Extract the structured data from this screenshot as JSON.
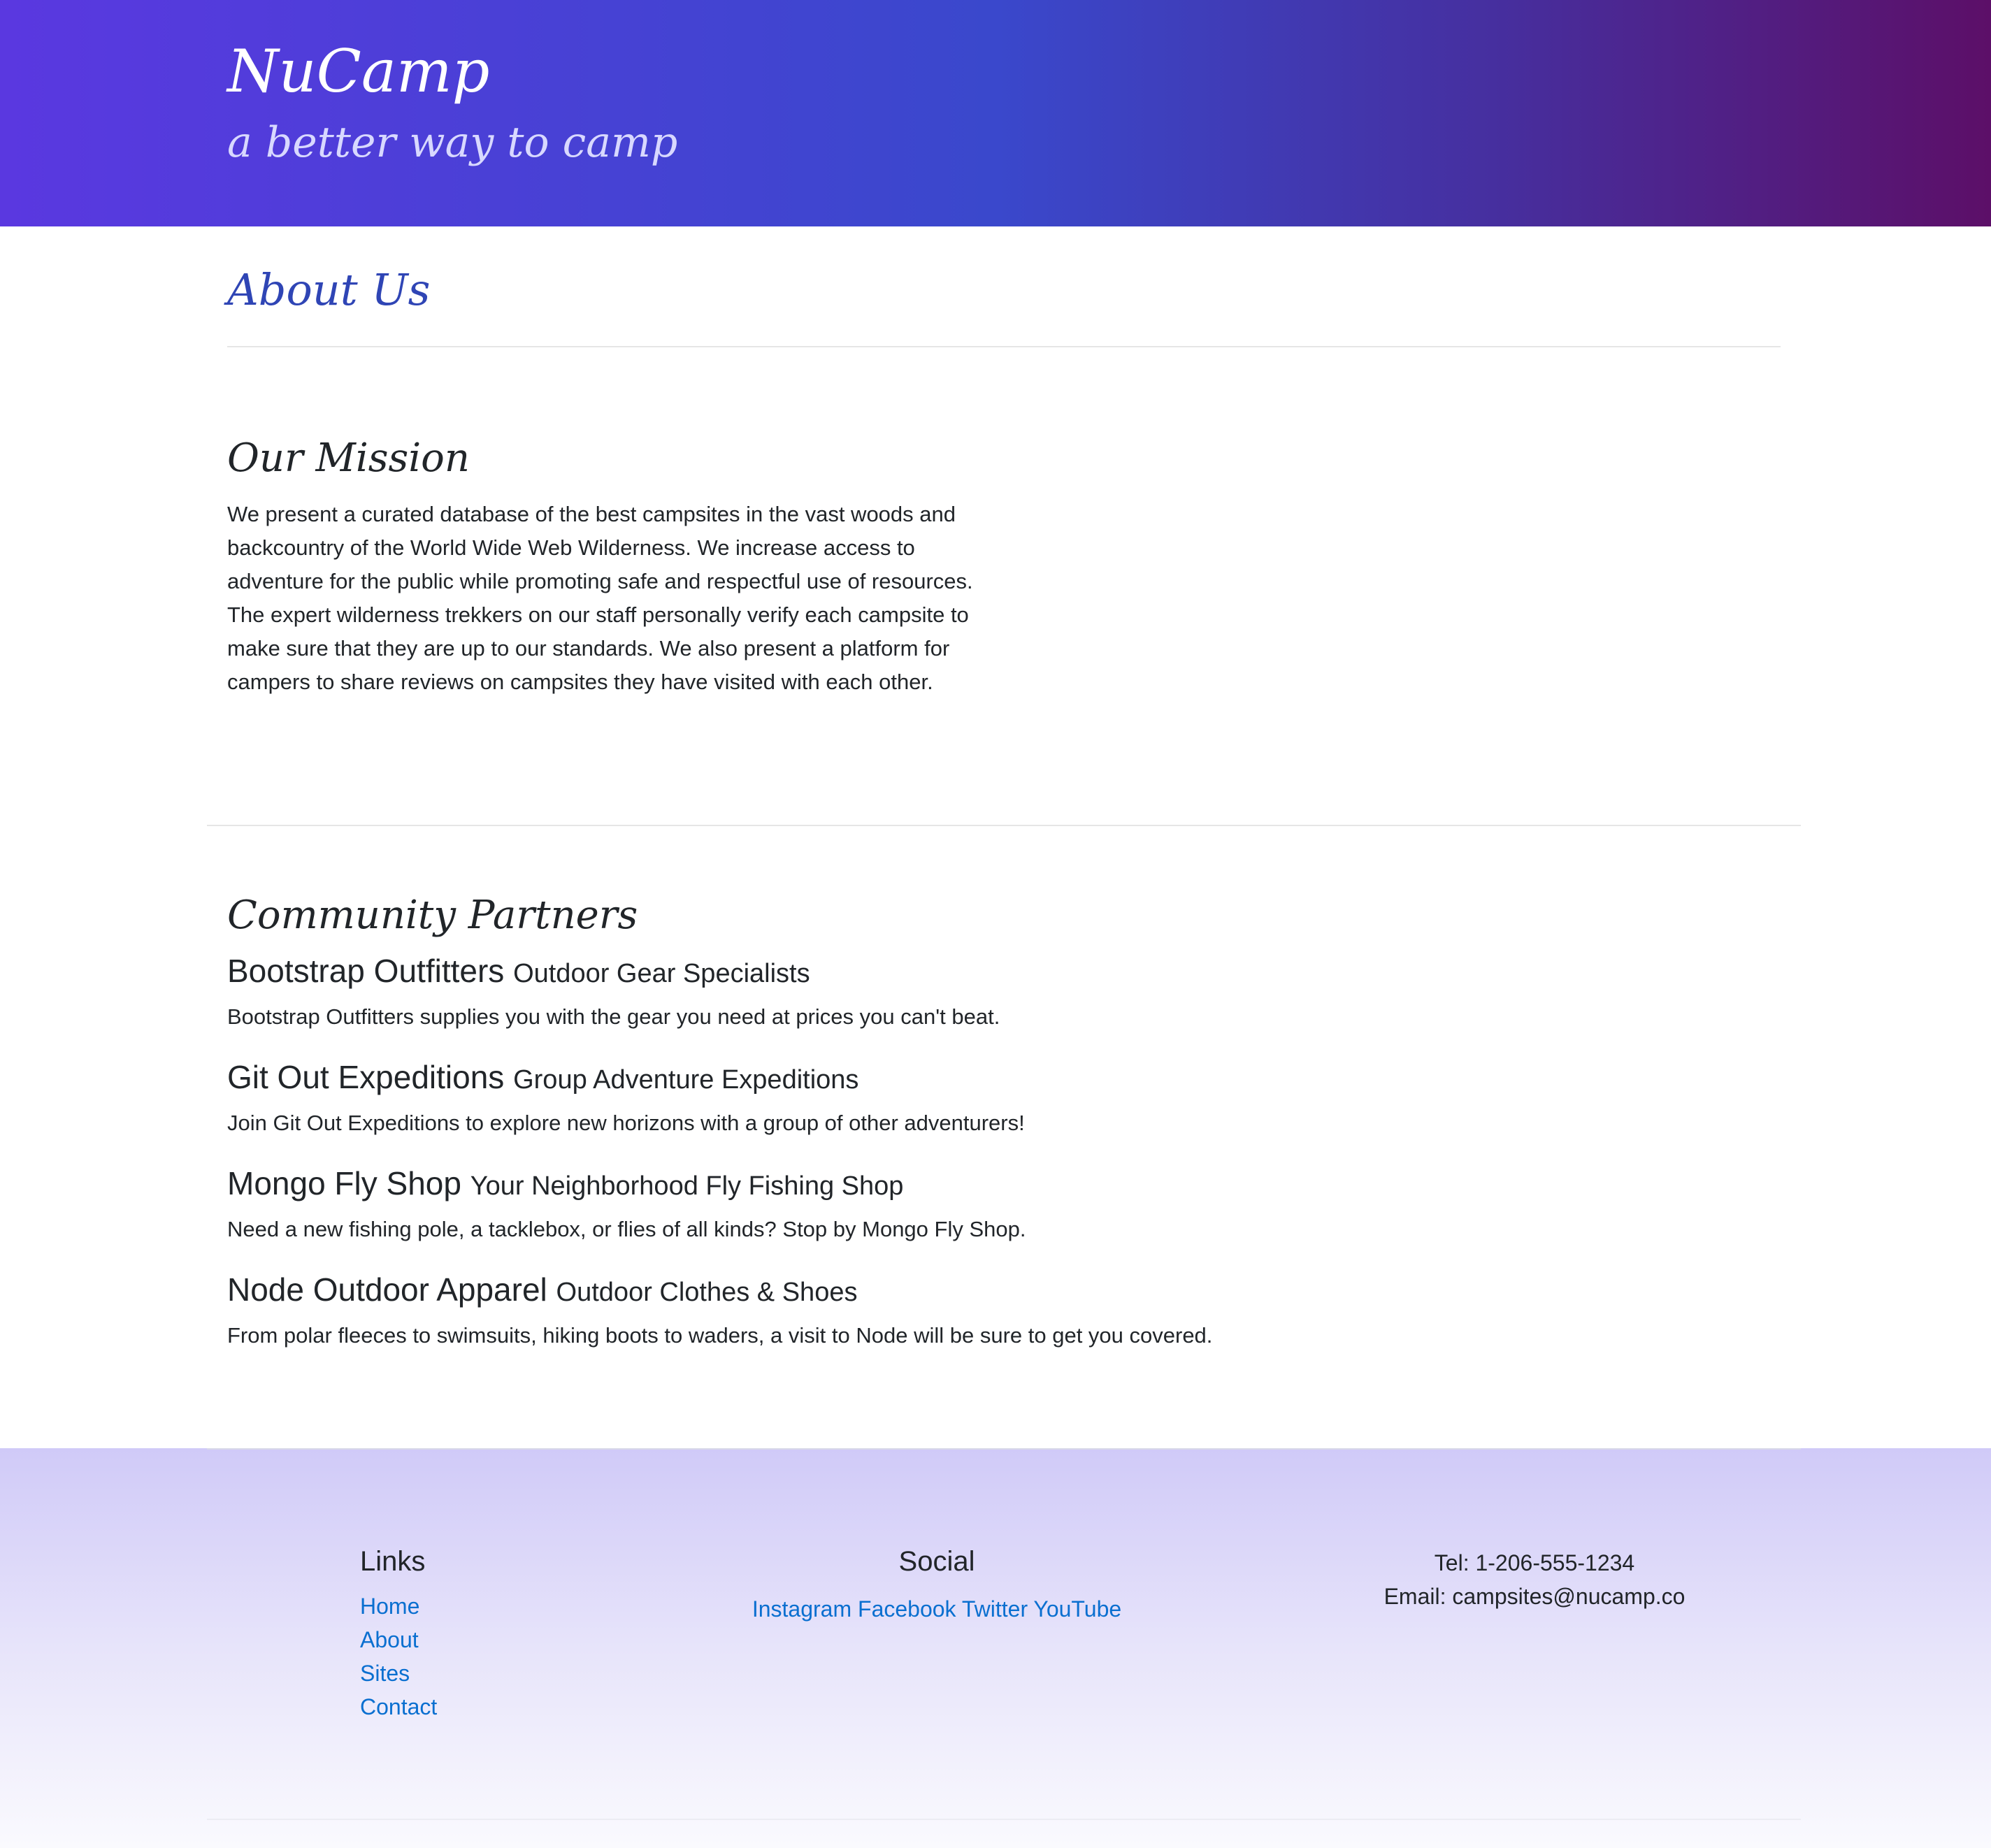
{
  "header": {
    "title": "NuCamp",
    "tagline": "a better way to camp"
  },
  "page_title": "About Us",
  "mission": {
    "heading": "Our Mission",
    "text": "We present a curated database of the best campsites in the vast woods and backcountry of the World Wide Web Wilderness. We increase access to adventure for the public while promoting safe and respectful use of resources. The expert wilderness trekkers on our staff personally verify each campsite to make sure that they are up to our standards. We also present a platform for campers to share reviews on campsites they have visited with each other."
  },
  "partners": {
    "heading": "Community Partners",
    "items": [
      {
        "name": "Bootstrap Outfitters",
        "subtitle": "Outdoor Gear Specialists",
        "description": "Bootstrap Outfitters supplies you with the gear you need at prices you can't beat."
      },
      {
        "name": "Git Out Expeditions",
        "subtitle": "Group Adventure Expeditions",
        "description": "Join Git Out Expeditions to explore new horizons with a group of other adventurers!"
      },
      {
        "name": "Mongo Fly Shop",
        "subtitle": "Your Neighborhood Fly Fishing Shop",
        "description": "Need a new fishing pole, a tacklebox, or flies of all kinds? Stop by Mongo Fly Shop."
      },
      {
        "name": "Node Outdoor Apparel",
        "subtitle": "Outdoor Clothes & Shoes",
        "description": "From polar fleeces to swimsuits, hiking boots to waders, a visit to Node will be sure to get you covered."
      }
    ]
  },
  "footer": {
    "links_heading": "Links",
    "links": [
      "Home",
      "About",
      "Sites",
      "Contact"
    ],
    "social_heading": "Social",
    "social": [
      "Instagram",
      "Facebook",
      "Twitter",
      "YouTube"
    ],
    "tel": "Tel: 1-206-555-1234",
    "email": "Email: campsites@nucamp.co"
  },
  "colors": {
    "link": "#0a6fd0",
    "page_title": "#2f45b5",
    "header_gradient_start": "#5a38e0",
    "header_gradient_end": "#5c0f68",
    "footer_gradient_start": "#d0caf8"
  }
}
